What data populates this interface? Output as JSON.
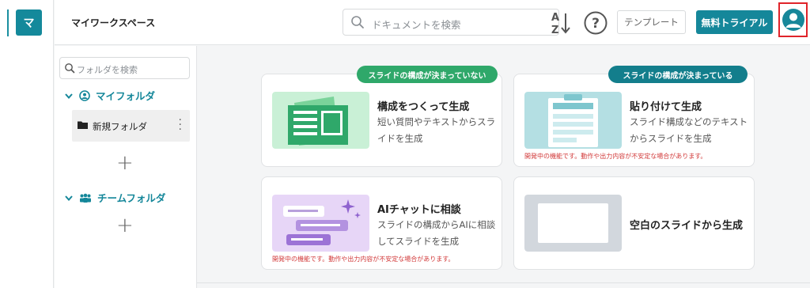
{
  "rail": {
    "logo_char": "マ"
  },
  "header": {
    "workspace_title": "マイワークスペース",
    "search_placeholder": "ドキュメントを検索",
    "sort_icon": "sort-az-icon",
    "help_icon": "help-circle-icon",
    "template_label": "テンプレート",
    "trial_label": "無料トライアル",
    "avatar_icon": "user-avatar-icon"
  },
  "sidebar": {
    "search_placeholder": "フォルダを検索",
    "my_folder": {
      "label": "マイフォルダ",
      "expanded": true
    },
    "folders": [
      {
        "name": "新規フォルダ"
      }
    ],
    "team_folder": {
      "label": "チームフォルダ",
      "expanded": true
    }
  },
  "main": {
    "badges": {
      "undecided": "スライドの構成が決まっていない",
      "decided": "スライドの構成が決まっている"
    },
    "cards": [
      {
        "title": "構成をつくって生成",
        "desc": "短い質問やテキストからスライドを生成",
        "warn": ""
      },
      {
        "title": "貼り付けて生成",
        "desc": "スライド構成などのテキストからスライドを生成",
        "warn": "開発中の機能です。動作や出力内容が不安定な場合があります。"
      },
      {
        "title": "AIチャットに相談",
        "desc": "スライドの構成からAIに相談してスライドを生成",
        "warn": "開発中の機能です。動作や出力内容が不安定な場合があります。"
      },
      {
        "title": "空白のスライドから生成",
        "desc": "",
        "warn": ""
      }
    ]
  },
  "colors": {
    "primary": "#15879a",
    "badge_green": "#2fa86a",
    "badge_teal": "#137e8c",
    "warn_red": "#d23a3a",
    "highlight_border": "#e0242a"
  }
}
